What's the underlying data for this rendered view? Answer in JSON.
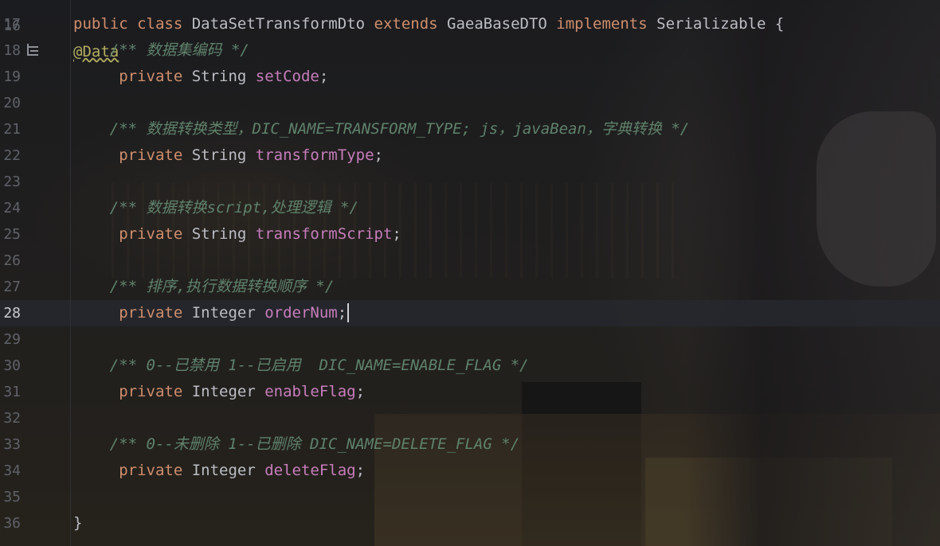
{
  "editor": {
    "annotation_text": "@Data",
    "annotation_line_number": "16",
    "lines": [
      {
        "num": "17",
        "tokens": [
          {
            "t": "kw",
            "v": "public "
          },
          {
            "t": "kw",
            "v": "class "
          },
          {
            "t": "cls",
            "v": "DataSetTransformDto "
          },
          {
            "t": "kw",
            "v": "extends "
          },
          {
            "t": "cls",
            "v": "GaeaBaseDTO "
          },
          {
            "t": "kw",
            "v": "implements "
          },
          {
            "t": "cls",
            "v": "Serializable {"
          }
        ]
      },
      {
        "num": "18",
        "indent": "    ",
        "tokens": [
          {
            "t": "cmt",
            "v": "/** 数据集编码 */"
          }
        ]
      },
      {
        "num": "19",
        "indent": "     ",
        "tokens": [
          {
            "t": "kw",
            "v": "private "
          },
          {
            "t": "cls",
            "v": "String "
          },
          {
            "t": "fld",
            "v": "setCode"
          },
          {
            "t": "cls",
            "v": ";"
          }
        ]
      },
      {
        "num": "20",
        "tokens": []
      },
      {
        "num": "21",
        "indent": "    ",
        "tokens": [
          {
            "t": "cmt",
            "v": "/** 数据转换类型，DIC_NAME=TRANSFORM_TYPE; js，javaBean，字典转换 */"
          }
        ]
      },
      {
        "num": "22",
        "indent": "     ",
        "tokens": [
          {
            "t": "kw",
            "v": "private "
          },
          {
            "t": "cls",
            "v": "String "
          },
          {
            "t": "fld",
            "v": "transformType"
          },
          {
            "t": "cls",
            "v": ";"
          }
        ]
      },
      {
        "num": "23",
        "tokens": []
      },
      {
        "num": "24",
        "indent": "    ",
        "tokens": [
          {
            "t": "cmt",
            "v": "/** 数据转换script,处理逻辑 */"
          }
        ]
      },
      {
        "num": "25",
        "indent": "     ",
        "tokens": [
          {
            "t": "kw",
            "v": "private "
          },
          {
            "t": "cls",
            "v": "String "
          },
          {
            "t": "fld",
            "v": "transformScript"
          },
          {
            "t": "cls",
            "v": ";"
          }
        ]
      },
      {
        "num": "26",
        "tokens": []
      },
      {
        "num": "27",
        "indent": "    ",
        "tokens": [
          {
            "t": "cmt",
            "v": "/** 排序,执行数据转换顺序 */"
          }
        ]
      },
      {
        "num": "28",
        "current": true,
        "indent": "     ",
        "tokens": [
          {
            "t": "kw",
            "v": "private "
          },
          {
            "t": "cls",
            "v": "Integer "
          },
          {
            "t": "fld",
            "v": "orderNum"
          },
          {
            "t": "cls",
            "v": ";"
          }
        ]
      },
      {
        "num": "29",
        "tokens": []
      },
      {
        "num": "30",
        "indent": "    ",
        "tokens": [
          {
            "t": "cmt",
            "v": "/** 0--已禁用 1--已启用  DIC_NAME=ENABLE_FLAG */"
          }
        ]
      },
      {
        "num": "31",
        "indent": "     ",
        "tokens": [
          {
            "t": "kw",
            "v": "private "
          },
          {
            "t": "cls",
            "v": "Integer "
          },
          {
            "t": "fld",
            "v": "enableFlag"
          },
          {
            "t": "cls",
            "v": ";"
          }
        ]
      },
      {
        "num": "32",
        "tokens": []
      },
      {
        "num": "33",
        "indent": "    ",
        "tokens": [
          {
            "t": "cmt",
            "v": "/** 0--未删除 1--已删除 DIC_NAME=DELETE_FLAG */"
          }
        ]
      },
      {
        "num": "34",
        "indent": "     ",
        "tokens": [
          {
            "t": "kw",
            "v": "private "
          },
          {
            "t": "cls",
            "v": "Integer "
          },
          {
            "t": "fld",
            "v": "deleteFlag"
          },
          {
            "t": "cls",
            "v": ";"
          }
        ]
      },
      {
        "num": "35",
        "tokens": []
      },
      {
        "num": "36",
        "tokens": [
          {
            "t": "cls",
            "v": "}"
          }
        ]
      }
    ]
  },
  "gutter_icons": {
    "line_18": "rendered-doc-icon"
  },
  "colors": {
    "background": "#1e1f22",
    "keyword": "#cf8e6d",
    "field": "#c77dbb",
    "comment": "#5f826b",
    "annotation": "#b3ae60",
    "text": "#bcbec4",
    "line_number": "#5f6268"
  }
}
